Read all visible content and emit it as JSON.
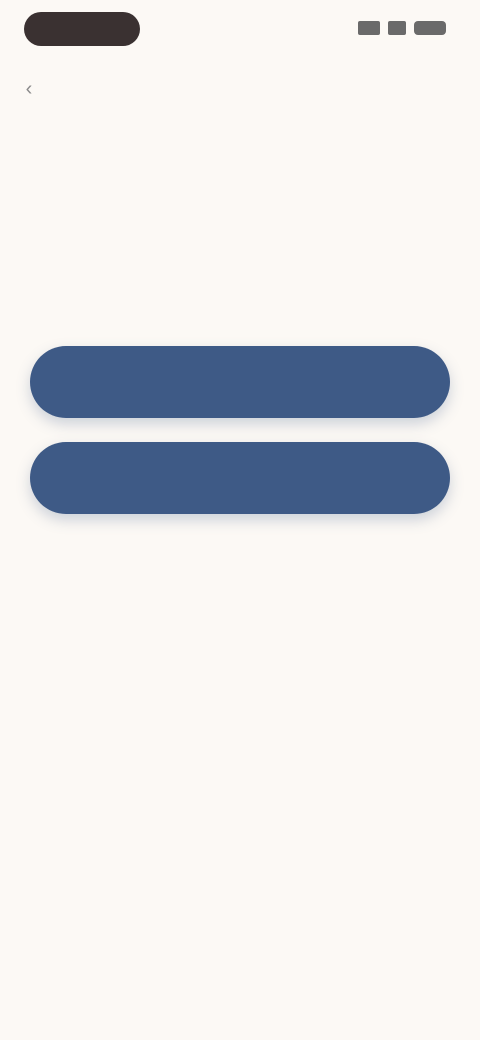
{
  "status_bar": {
    "time": "",
    "icons": [
      "signal-icon",
      "wifi-icon",
      "battery-icon"
    ]
  },
  "nav": {
    "back_icon": "chevron-left-icon",
    "back_glyph": "‹"
  },
  "content": {
    "title": "",
    "description": ""
  },
  "actions": {
    "primary_label": "",
    "secondary_label": ""
  },
  "colors": {
    "background": "#fcf9f5",
    "button": "#3e5a86",
    "title_text": "#4a4a4a",
    "body_text": "#9a9a9a"
  }
}
